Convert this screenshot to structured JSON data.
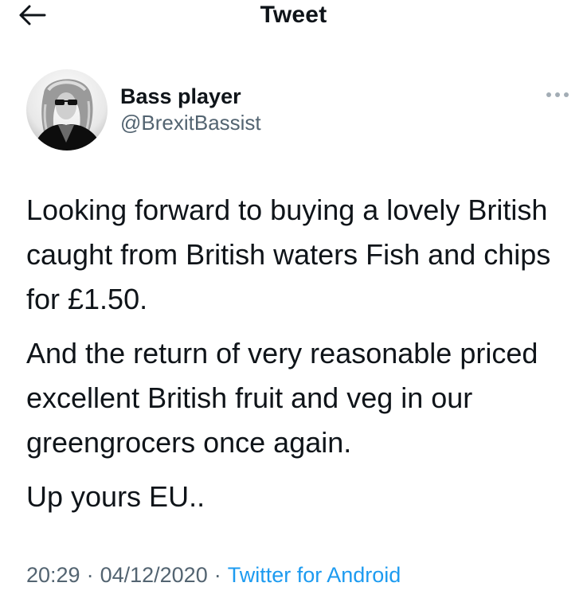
{
  "header": {
    "title": "Tweet",
    "back_icon": "arrow-left-icon"
  },
  "author": {
    "display_name": "Bass player",
    "handle": "@BrexitBassist",
    "avatar": "avatar-image",
    "more_icon": "more-horizontal-icon"
  },
  "tweet": {
    "paragraphs": [
      "Looking forward to buying a lovely British caught from British waters Fish and chips for £1.50.",
      "And the return of very reasonable priced excellent British fruit and veg in our greengrocers once again.",
      "Up yours EU.."
    ]
  },
  "meta": {
    "time": "20:29",
    "separator": "·",
    "date": "04/12/2020",
    "source": "Twitter for Android"
  },
  "colors": {
    "text": "#0f1419",
    "muted": "#536471",
    "link": "#1d9bf0"
  }
}
